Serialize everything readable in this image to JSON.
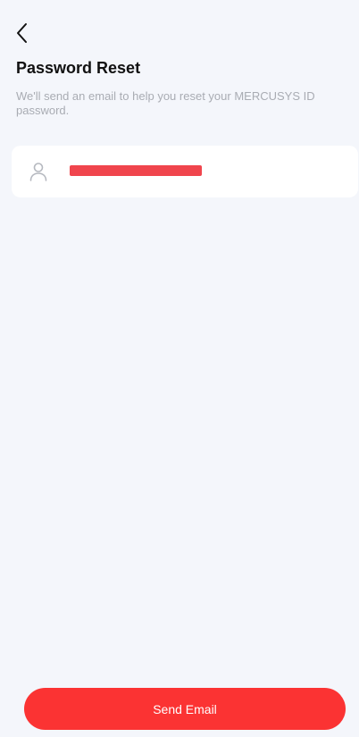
{
  "header": {
    "back_icon": "chevron-left-icon",
    "title": "Password Reset",
    "subtitle": "We'll send an email to help you reset your MERCUSYS ID password."
  },
  "email_field": {
    "icon": "user-icon",
    "value": "",
    "placeholder": ""
  },
  "footer": {
    "send_label": "Send Email"
  },
  "colors": {
    "background": "#f4f6fb",
    "accent": "#fb3333",
    "redaction": "#f0454d"
  }
}
